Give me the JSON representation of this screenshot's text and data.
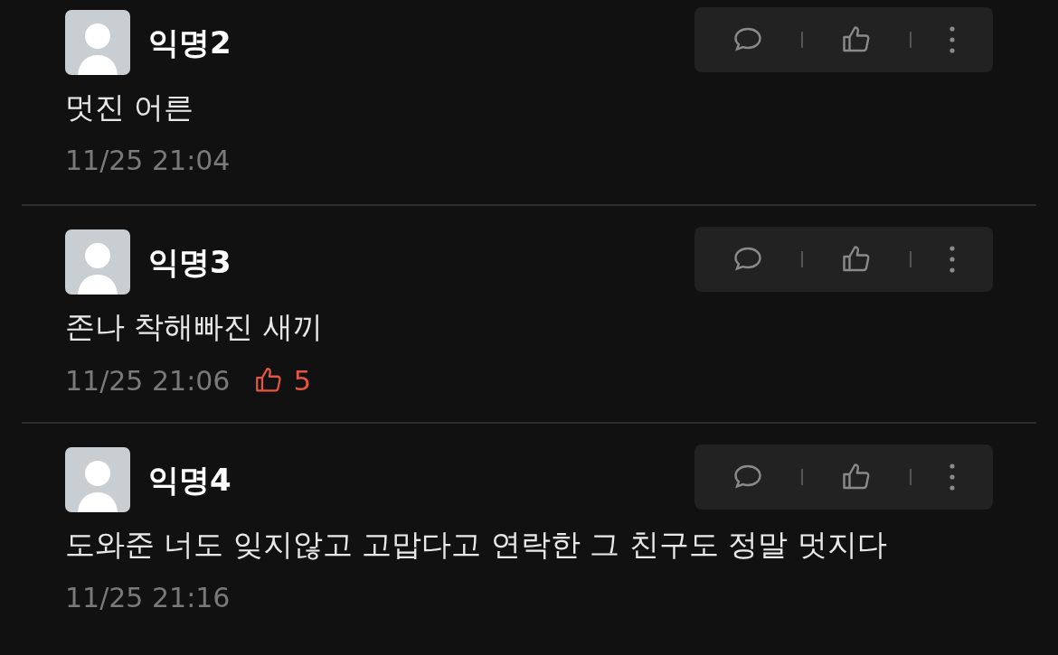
{
  "comments": [
    {
      "author": "익명2",
      "body": "멋진 어른",
      "time": "11/25 21:04"
    },
    {
      "author": "익명3",
      "body": "존나 착해빠진 새끼",
      "time": "11/25 21:06",
      "likes": "5"
    },
    {
      "author": "익명4",
      "body": "도와준 너도 잊지않고 고맙다고 연락한 그 친구도 정말 멋지다",
      "time": "11/25 21:16"
    }
  ]
}
